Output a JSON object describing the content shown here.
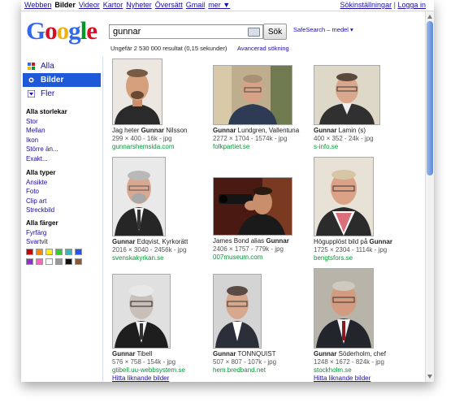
{
  "topnav": {
    "items": [
      "Webben",
      "Bilder",
      "Videor",
      "Kartor",
      "Nyheter",
      "Översätt",
      "Gmail",
      "mer ▼"
    ],
    "current_index": 1,
    "settings": "Sökinställningar",
    "separator": "|",
    "login": "Logga in"
  },
  "logo": {
    "letters": [
      "G",
      "o",
      "o",
      "g",
      "l",
      "e"
    ],
    "colors": [
      "#3369e8",
      "#d50f25",
      "#eeb211",
      "#3369e8",
      "#009925",
      "#d50f25"
    ]
  },
  "search": {
    "query": "gunnar",
    "button": "Sök",
    "safesearch": "SafeSearch – medel ▾",
    "stats": "Ungefär 2 530 000 resultat (0,15 sekunder)",
    "advanced": "Avancerad sökning"
  },
  "leftnav": {
    "modes": [
      "Alla",
      "Bilder",
      "Fler"
    ],
    "selected": 1,
    "size_header": "Alla storlekar",
    "sizes": [
      "Stor",
      "Mellan",
      "Ikon",
      "Större än...",
      "Exakt..."
    ],
    "type_header": "Alla typer",
    "types": [
      "Ansikte",
      "Foto",
      "Clip art",
      "Streckbild"
    ],
    "color_header": "Alla färger",
    "colors": [
      "Fyrfärg",
      "Svartvit"
    ],
    "swatches": [
      "#cc0000",
      "#ff8800",
      "#ffee00",
      "#33cc33",
      "#33bbbb",
      "#2255ee",
      "#8833cc",
      "#ff66bb",
      "#ffffff",
      "#999999",
      "#111111",
      "#8b5a2b"
    ]
  },
  "results": [
    {
      "pre": "Jag heter ",
      "bold": "Gunnar",
      "post": " Nilsson",
      "meta": "299 × 400 - 16k - jpg",
      "source": "gunnarshemsida.com",
      "similar": ""
    },
    {
      "pre": "",
      "bold": "Gunnar",
      "post": " Lundgren, Vallentuna",
      "meta": "2272 × 1704 - 1574k - jpg",
      "source": "folkpartiet.se",
      "similar": ""
    },
    {
      "pre": "",
      "bold": "Gunnar",
      "post": " Lamin (s)",
      "meta": "400 × 352 - 24k - jpg",
      "source": "s-info.se",
      "similar": ""
    },
    {
      "pre": "",
      "bold": "Gunnar",
      "post": " Edqvist, Kyrkorätt",
      "meta": "2016 × 3040 - 2456k - jpg",
      "source": "svenskakyrkan.se",
      "similar": ""
    },
    {
      "pre": "James Bond alias ",
      "bold": "Gunnar",
      "post": "",
      "meta": "2406 × 1757 - 779k - jpg",
      "source": "007museum.com",
      "similar": ""
    },
    {
      "pre": "Högupplöst bild på ",
      "bold": "Gunnar",
      "post": "",
      "meta": "1725 × 2304 - 1114k - jpg",
      "source": "bengtsfors.se",
      "similar": ""
    },
    {
      "pre": "",
      "bold": "Gunnar",
      "post": " Tibell",
      "meta": "576 × 758 - 154k - jpg",
      "source": "gtibell.uu-webbsystem.se",
      "similar": "Hitta liknande bilder"
    },
    {
      "pre": "",
      "bold": "Gunnar",
      "post": " TONNQUIST",
      "meta": "507 × 807 - 107k - jpg",
      "source": "hem.bredband.net",
      "similar": ""
    },
    {
      "pre": "",
      "bold": "Gunnar",
      "post": " Söderholm, chef",
      "meta": "1248 × 1672 - 824k - jpg",
      "source": "stockholm.se",
      "similar": "Hitta liknande bilder"
    }
  ]
}
